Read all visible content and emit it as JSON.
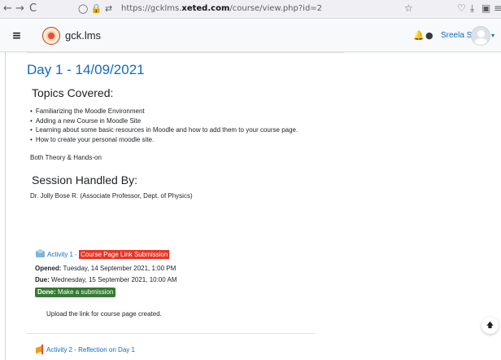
{
  "browser": {
    "back_icon": "←",
    "forward_icon": "→",
    "reload_icon": "C",
    "url_prefix": "https://gcklms.",
    "url_domain": "xeted.com",
    "url_path": "/course/view.php?id=2",
    "bookmark_icon": "☆",
    "pocket_icon": "♡",
    "download_icon": "⤓",
    "extensions_icon": "▣",
    "menu_icon": "≡"
  },
  "navbar": {
    "menu_icon": "≡",
    "site_name": "gck.lms",
    "notification_icon": "🔔",
    "messages_icon": "●",
    "user_name": "Sreela S R",
    "caret_icon": "▾"
  },
  "section": {
    "title": "Day 1 - 14/09/2021",
    "topics_heading": "Topics Covered:",
    "topics": [
      "Familiarizing the Moodle Environment",
      "Adding a new Course in Moodle Site",
      "Learning about some basic resources in Moodle and how to add them to your course page.",
      "How to create your personal moodle site."
    ],
    "theory_note": "Both Theory & Hands-on",
    "session_heading": "Session Handled By:",
    "handler": "Dr. Jolly Bose R. (Associate Professor, Dept. of Physics)"
  },
  "activity1": {
    "prefix": "Activity 1 - ",
    "highlight": "Course Page Link Submission",
    "opened_label": "Opened:",
    "opened_value": "Tuesday, 14 September 2021, 1:00 PM",
    "due_label": "Due:",
    "due_value": "Wednesday, 15 September 2021, 10:00 AM",
    "done_label": "Done:",
    "done_value": "Make a submission",
    "description": "Upload the link for course page created."
  },
  "activity2": {
    "title": "Activity 2 - Reflection on Day 1"
  },
  "scroll_top_icon": "🡅",
  "colors": {
    "link": "#0f6cbf",
    "highlight": "#ea3323",
    "done_badge": "#357a32"
  }
}
